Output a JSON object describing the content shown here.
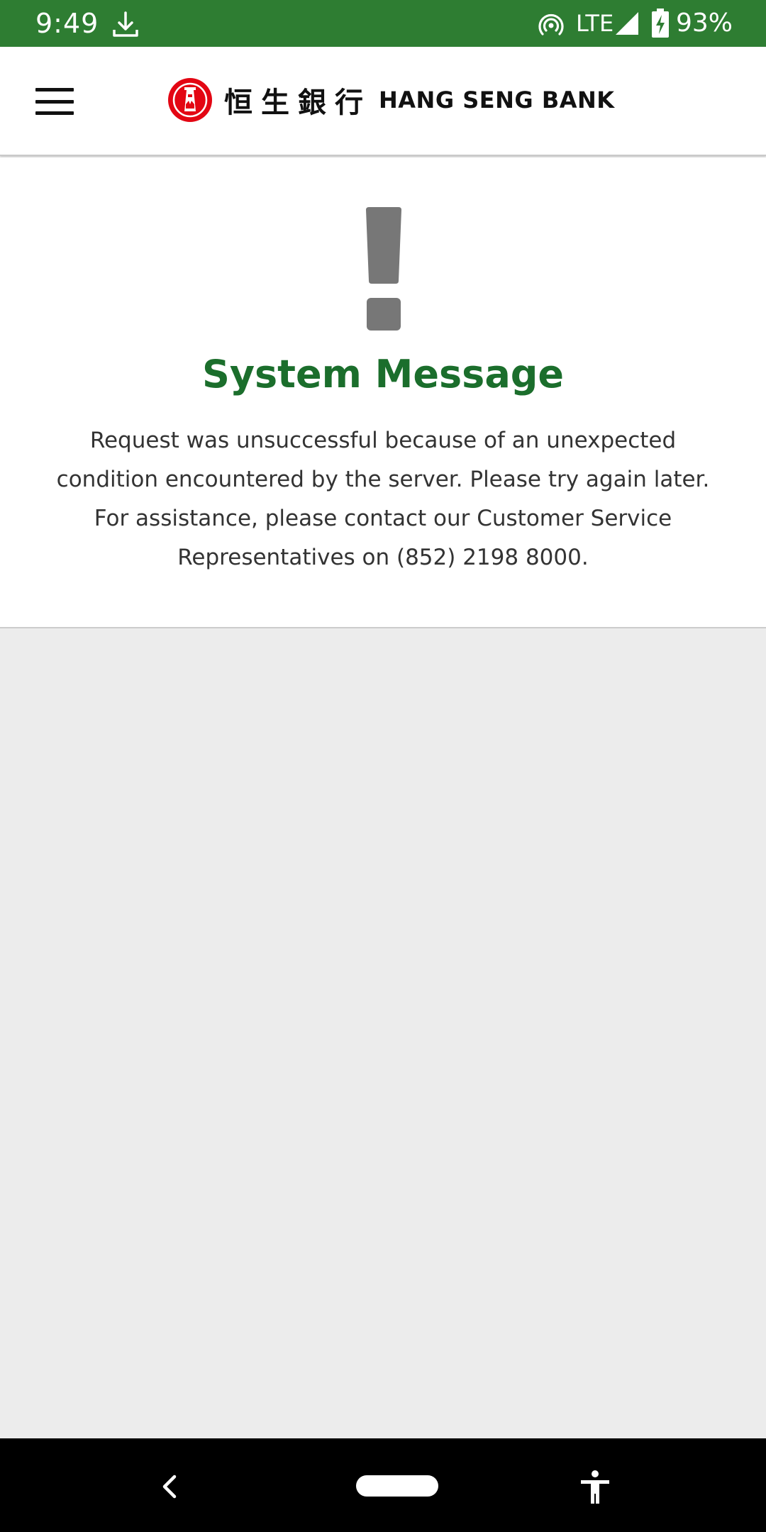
{
  "status_bar": {
    "time": "9:49",
    "network": "LTE",
    "battery": "93%",
    "icons": [
      "download-icon",
      "hotspot-icon",
      "signal-icon",
      "battery-charging-icon"
    ]
  },
  "header": {
    "menu_icon": "hamburger-menu-icon",
    "logo_chinese": "恒生銀行",
    "logo_english": "HANG SENG BANK",
    "brand_color": "#e30613"
  },
  "message": {
    "icon": "exclamation-icon",
    "title": "System Message",
    "body": "Request was unsuccessful because of an unexpected condition encountered by the server. Please try again later. For assistance, please contact our Customer Service Representatives on (852) 2198 8000."
  },
  "colors": {
    "status_bar": "#2e7d32",
    "title": "#1b6e2c",
    "body_text": "#333333",
    "page_background": "#ececec"
  },
  "nav_bar": {
    "icons": [
      "back-icon",
      "home-pill",
      "accessibility-icon"
    ]
  }
}
